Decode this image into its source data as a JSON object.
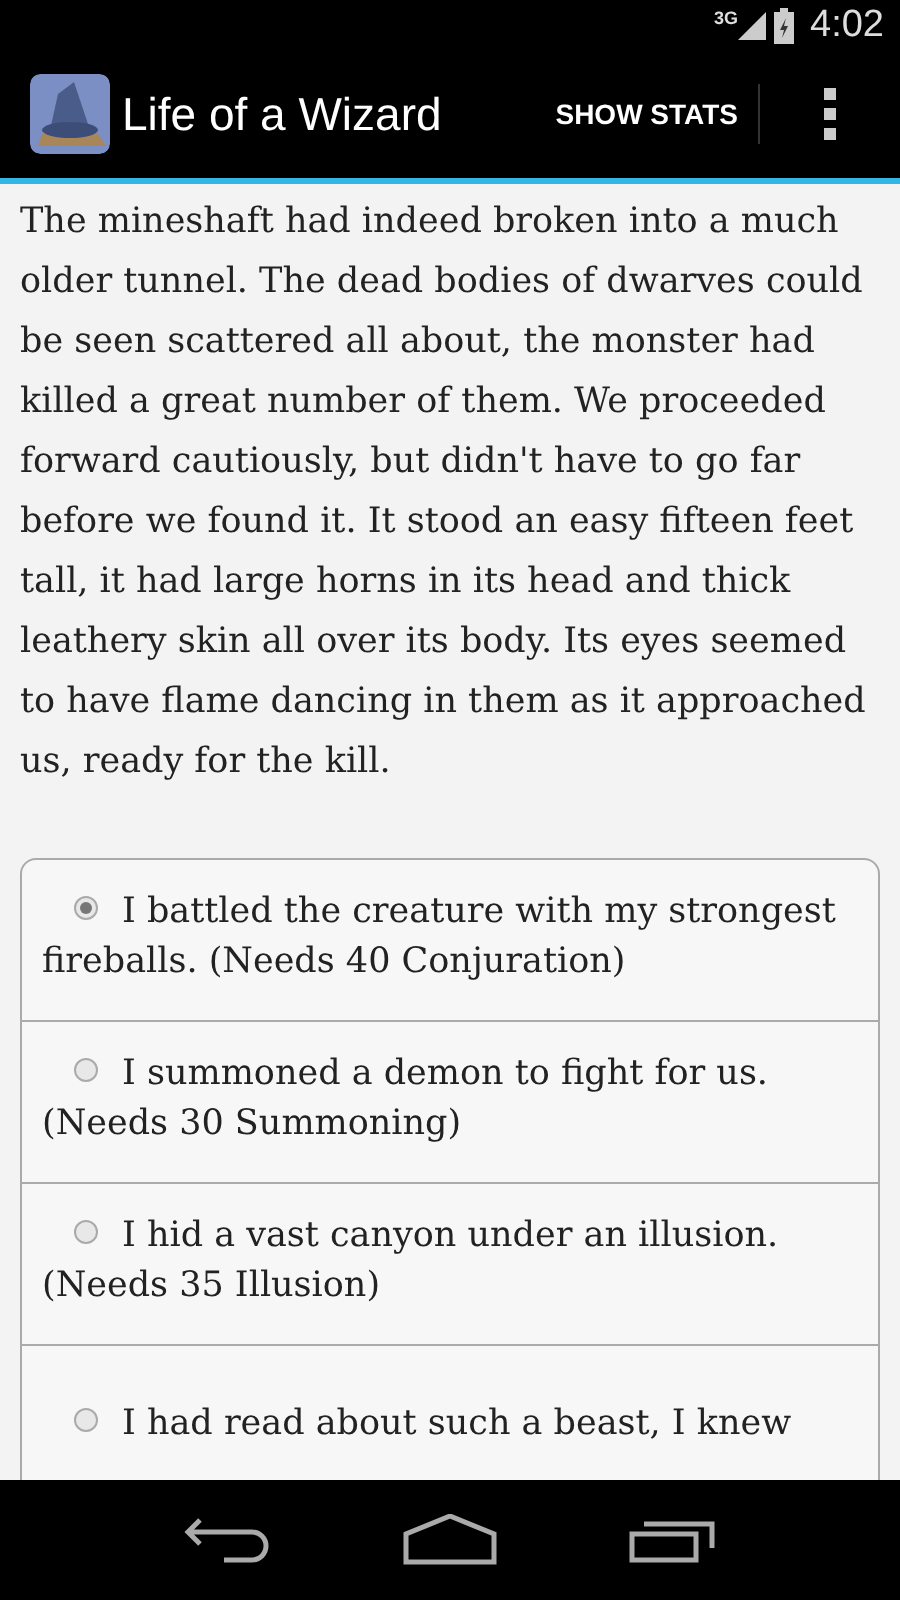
{
  "status_bar": {
    "network": "3G",
    "time": "4:02"
  },
  "action_bar": {
    "title": "Life of a Wizard",
    "action": "SHOW STATS"
  },
  "story": "The mineshaft had indeed broken into a much older tunnel. The dead bodies of dwarves could be seen scattered all about, the monster had killed a great number of them. We proceeded forward cautiously, but didn't have to go far before we found it. It stood an easy fifteen feet tall, it had large horns in its head and thick leathery skin all over its body. Its eyes seemed to have flame dancing in them as it approached us, ready for the kill.",
  "choices": [
    {
      "text": "I battled the creature with my strongest fireballs. (Needs 40 Conjuration)",
      "selected": true
    },
    {
      "text": "I summoned a demon to fight for us. (Needs 30 Summoning)",
      "selected": false
    },
    {
      "text": "I hid a vast canyon under an illusion. (Needs 35 Illusion)",
      "selected": false
    },
    {
      "text": "I had read about such a beast, I knew",
      "selected": false
    }
  ]
}
